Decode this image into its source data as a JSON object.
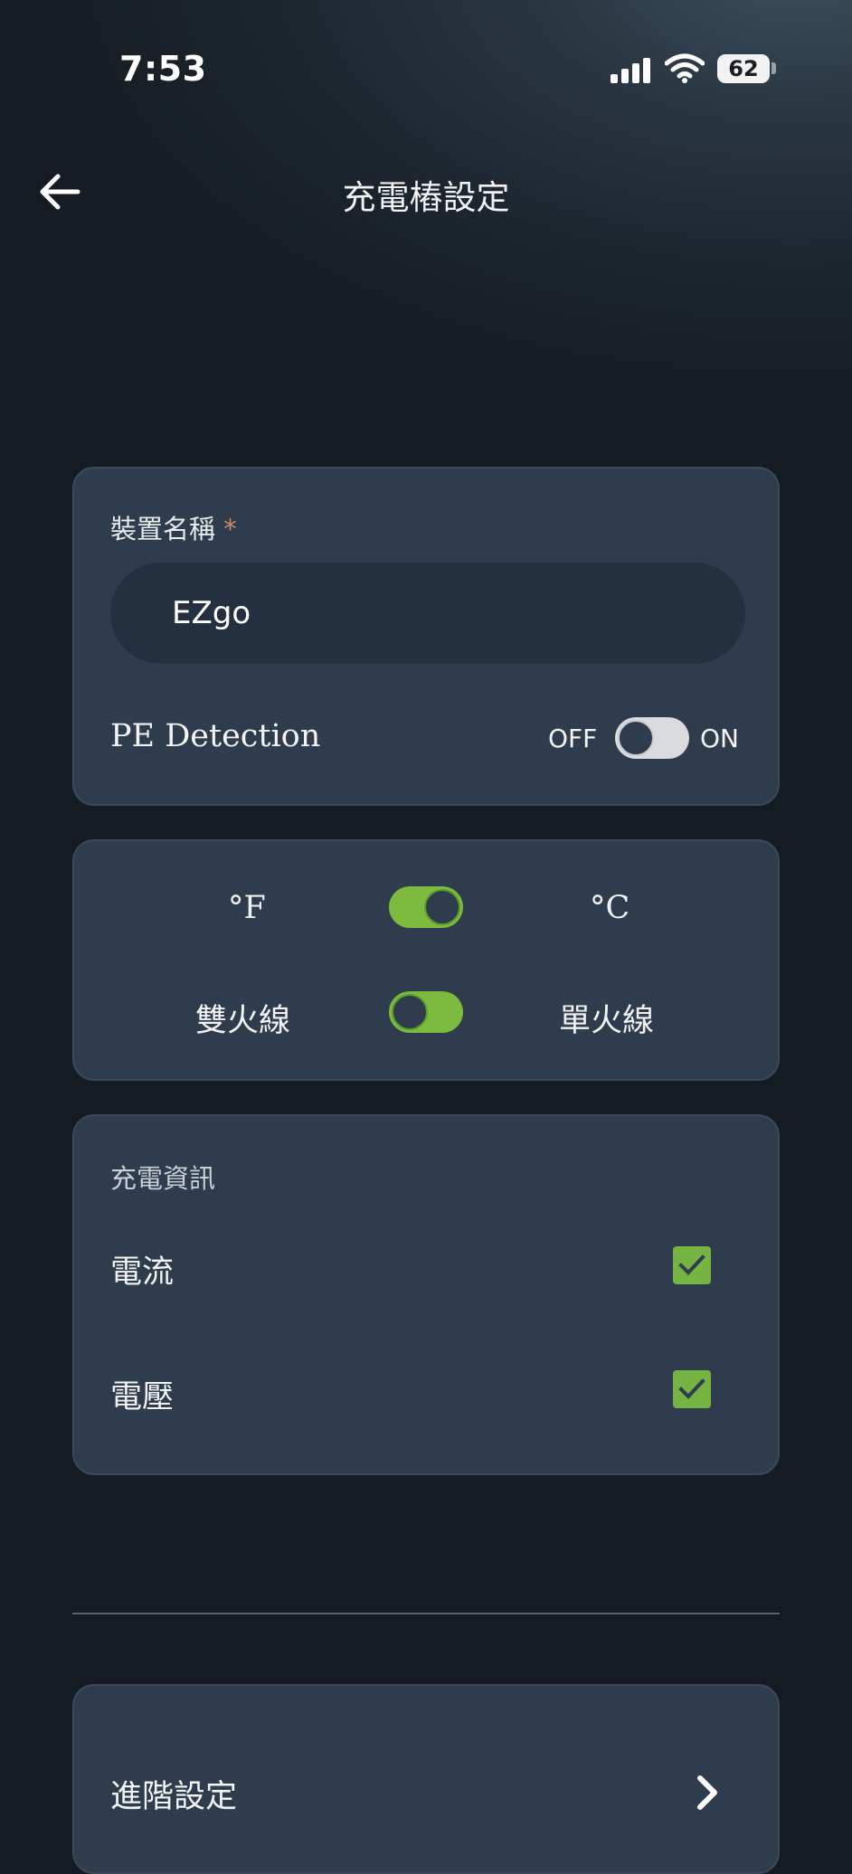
{
  "status_bar": {
    "time": "7:53",
    "battery": "62"
  },
  "header": {
    "title": "充電樁設定"
  },
  "device": {
    "name_label": "裝置名稱",
    "required_mark": "*",
    "name_value": "EZgo",
    "pe_detection_label": "PE Detection",
    "pe_off_label": "OFF",
    "pe_on_label": "ON",
    "pe_detection_on": false
  },
  "units": {
    "fahrenheit_label": "°F",
    "celsius_label": "°C",
    "temperature_unit": "°C",
    "dual_live_label": "雙火線",
    "single_live_label": "單火線",
    "live_wire_mode": "雙火線"
  },
  "charging_info": {
    "section_label": "充電資訊",
    "items": [
      {
        "label": "電流",
        "checked": true
      },
      {
        "label": "電壓",
        "checked": true
      }
    ]
  },
  "advanced": {
    "label": "進階設定"
  },
  "colors": {
    "accent_green": "#7cbb3f",
    "card_bg": "#2f3c4d",
    "page_bg": "#151b22"
  }
}
